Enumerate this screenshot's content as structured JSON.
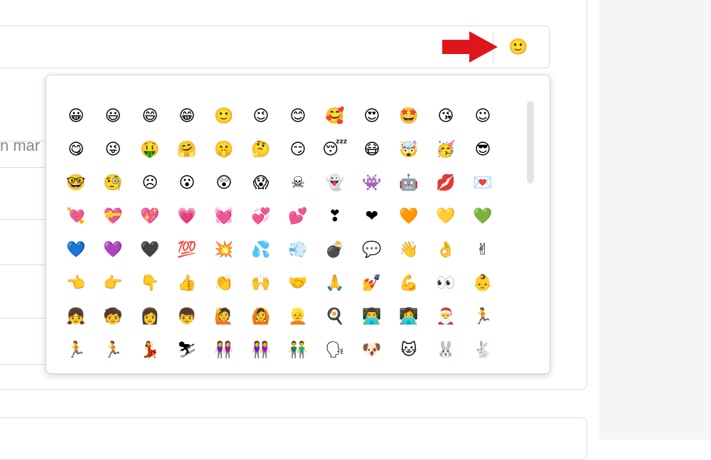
{
  "background_field": {
    "placeholder_fragment": "n mar"
  },
  "message_input": {
    "emoji_button_icon": "🙂"
  },
  "emoji_picker": {
    "rows": [
      [
        "😀",
        "😃",
        "😄",
        "😁",
        "🙂",
        "😉",
        "😊",
        "🥰",
        "😍",
        "🤩",
        "😘",
        "☺"
      ],
      [
        "😋",
        "😜",
        "🤑",
        "🤗",
        "🤫",
        "🤔",
        "😏",
        "😴",
        "😷",
        "🤯",
        "🥳",
        "😎"
      ],
      [
        "🤓",
        "🧐",
        "☹",
        "😮",
        "😲",
        "😱",
        "☠",
        "👻",
        "👾",
        "🤖",
        "💋",
        "💌"
      ],
      [
        "💘",
        "💝",
        "💖",
        "💗",
        "💓",
        "💞",
        "💕",
        "❣",
        "❤",
        "🧡",
        "💛",
        "💚"
      ],
      [
        "💙",
        "💜",
        "🖤",
        "💯",
        "💥",
        "💦",
        "💨",
        "💣",
        "💬",
        "👋",
        "👌",
        "✌"
      ],
      [
        "👈",
        "👉",
        "👇",
        "👍",
        "👏",
        "🙌",
        "🤝",
        "🙏",
        "💅",
        "💪",
        "👀",
        "👶"
      ],
      [
        "👧",
        "🧒",
        "👩",
        "👦",
        "🙋",
        "🙆",
        "👱",
        "🍳",
        "👨‍💻",
        "👩‍💻",
        "🎅",
        "🏃"
      ],
      [
        "🏃",
        "🏃",
        "💃",
        "⛷",
        "👭",
        "👭",
        "👬",
        "🗣",
        "🐶",
        "🐱",
        "🐰",
        "🐇"
      ],
      [
        "🐶",
        "🐱",
        "🐭",
        "🐹",
        "🐰",
        "🦊",
        "🐻",
        "🐼",
        "🐨",
        "🐯",
        "🦁",
        "🐮"
      ]
    ]
  },
  "colors": {
    "arrow": "#e0141b",
    "border": "#d6d6d6",
    "side_panel": "#f5f5f5",
    "scrollbar_thumb": "#e3e3e3"
  }
}
